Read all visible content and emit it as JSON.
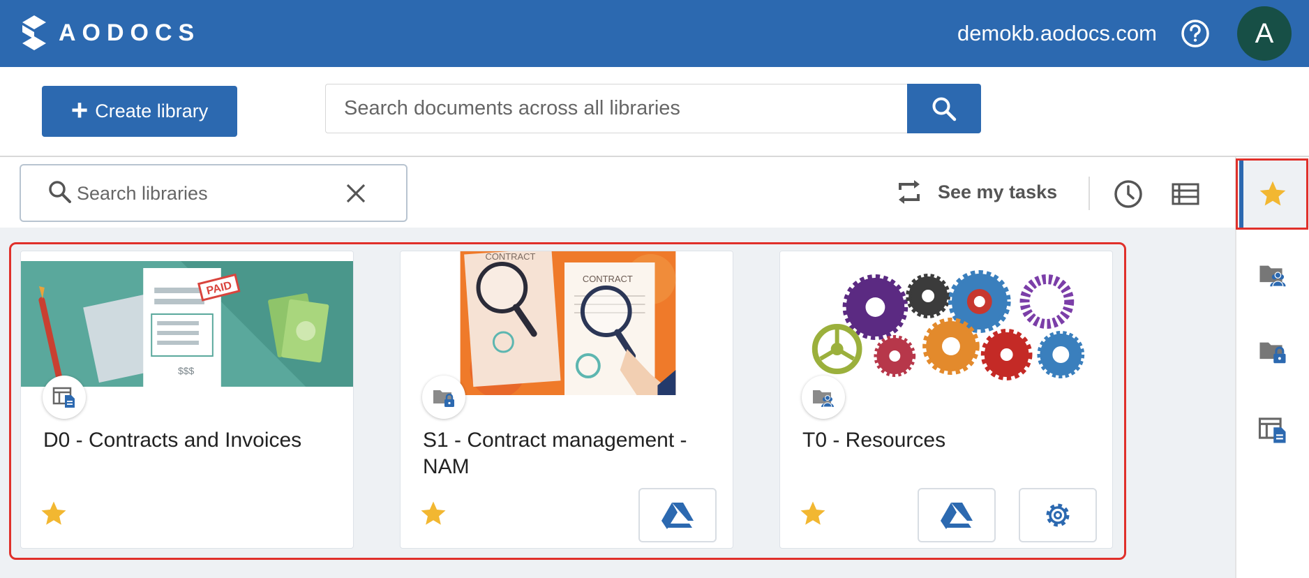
{
  "app": {
    "logo_text": "AODOCS",
    "domain": "demokb.aodocs.com",
    "avatar_initial": "A",
    "icons": {
      "help": "help-circle-icon",
      "logo": "aodocs-logo-icon"
    }
  },
  "header": {
    "create_library_label": "Create library",
    "global_search_placeholder": "Search documents across all libraries"
  },
  "toolbar": {
    "library_search_placeholder": "Search libraries",
    "tasks_label": "See my tasks"
  },
  "libraries": [
    {
      "title": "D0 - Contracts and Invoices",
      "type_icon": "document-library-icon",
      "starred": true,
      "actions": []
    },
    {
      "title": "S1 - Contract management - NAM",
      "type_icon": "secured-folder-icon",
      "starred": true,
      "actions": [
        "google-drive"
      ]
    },
    {
      "title": "T0 - Resources",
      "type_icon": "team-folder-icon",
      "starred": true,
      "actions": [
        "google-drive",
        "settings"
      ]
    }
  ],
  "banner_text": {
    "paid": "PAID",
    "amount": "$$$",
    "contract_1": "CONTRACT",
    "contract_2": "CONTRACT"
  },
  "rail": {
    "items": [
      "favorites-star-icon",
      "team-folder-icon",
      "secured-folder-icon",
      "document-library-icon"
    ],
    "active": "favorites-star-icon"
  },
  "colors": {
    "brand_blue": "#2c69b0",
    "star_gold": "#f2b731",
    "avatar_green": "#174f46",
    "highlight_red": "#e0302a"
  }
}
